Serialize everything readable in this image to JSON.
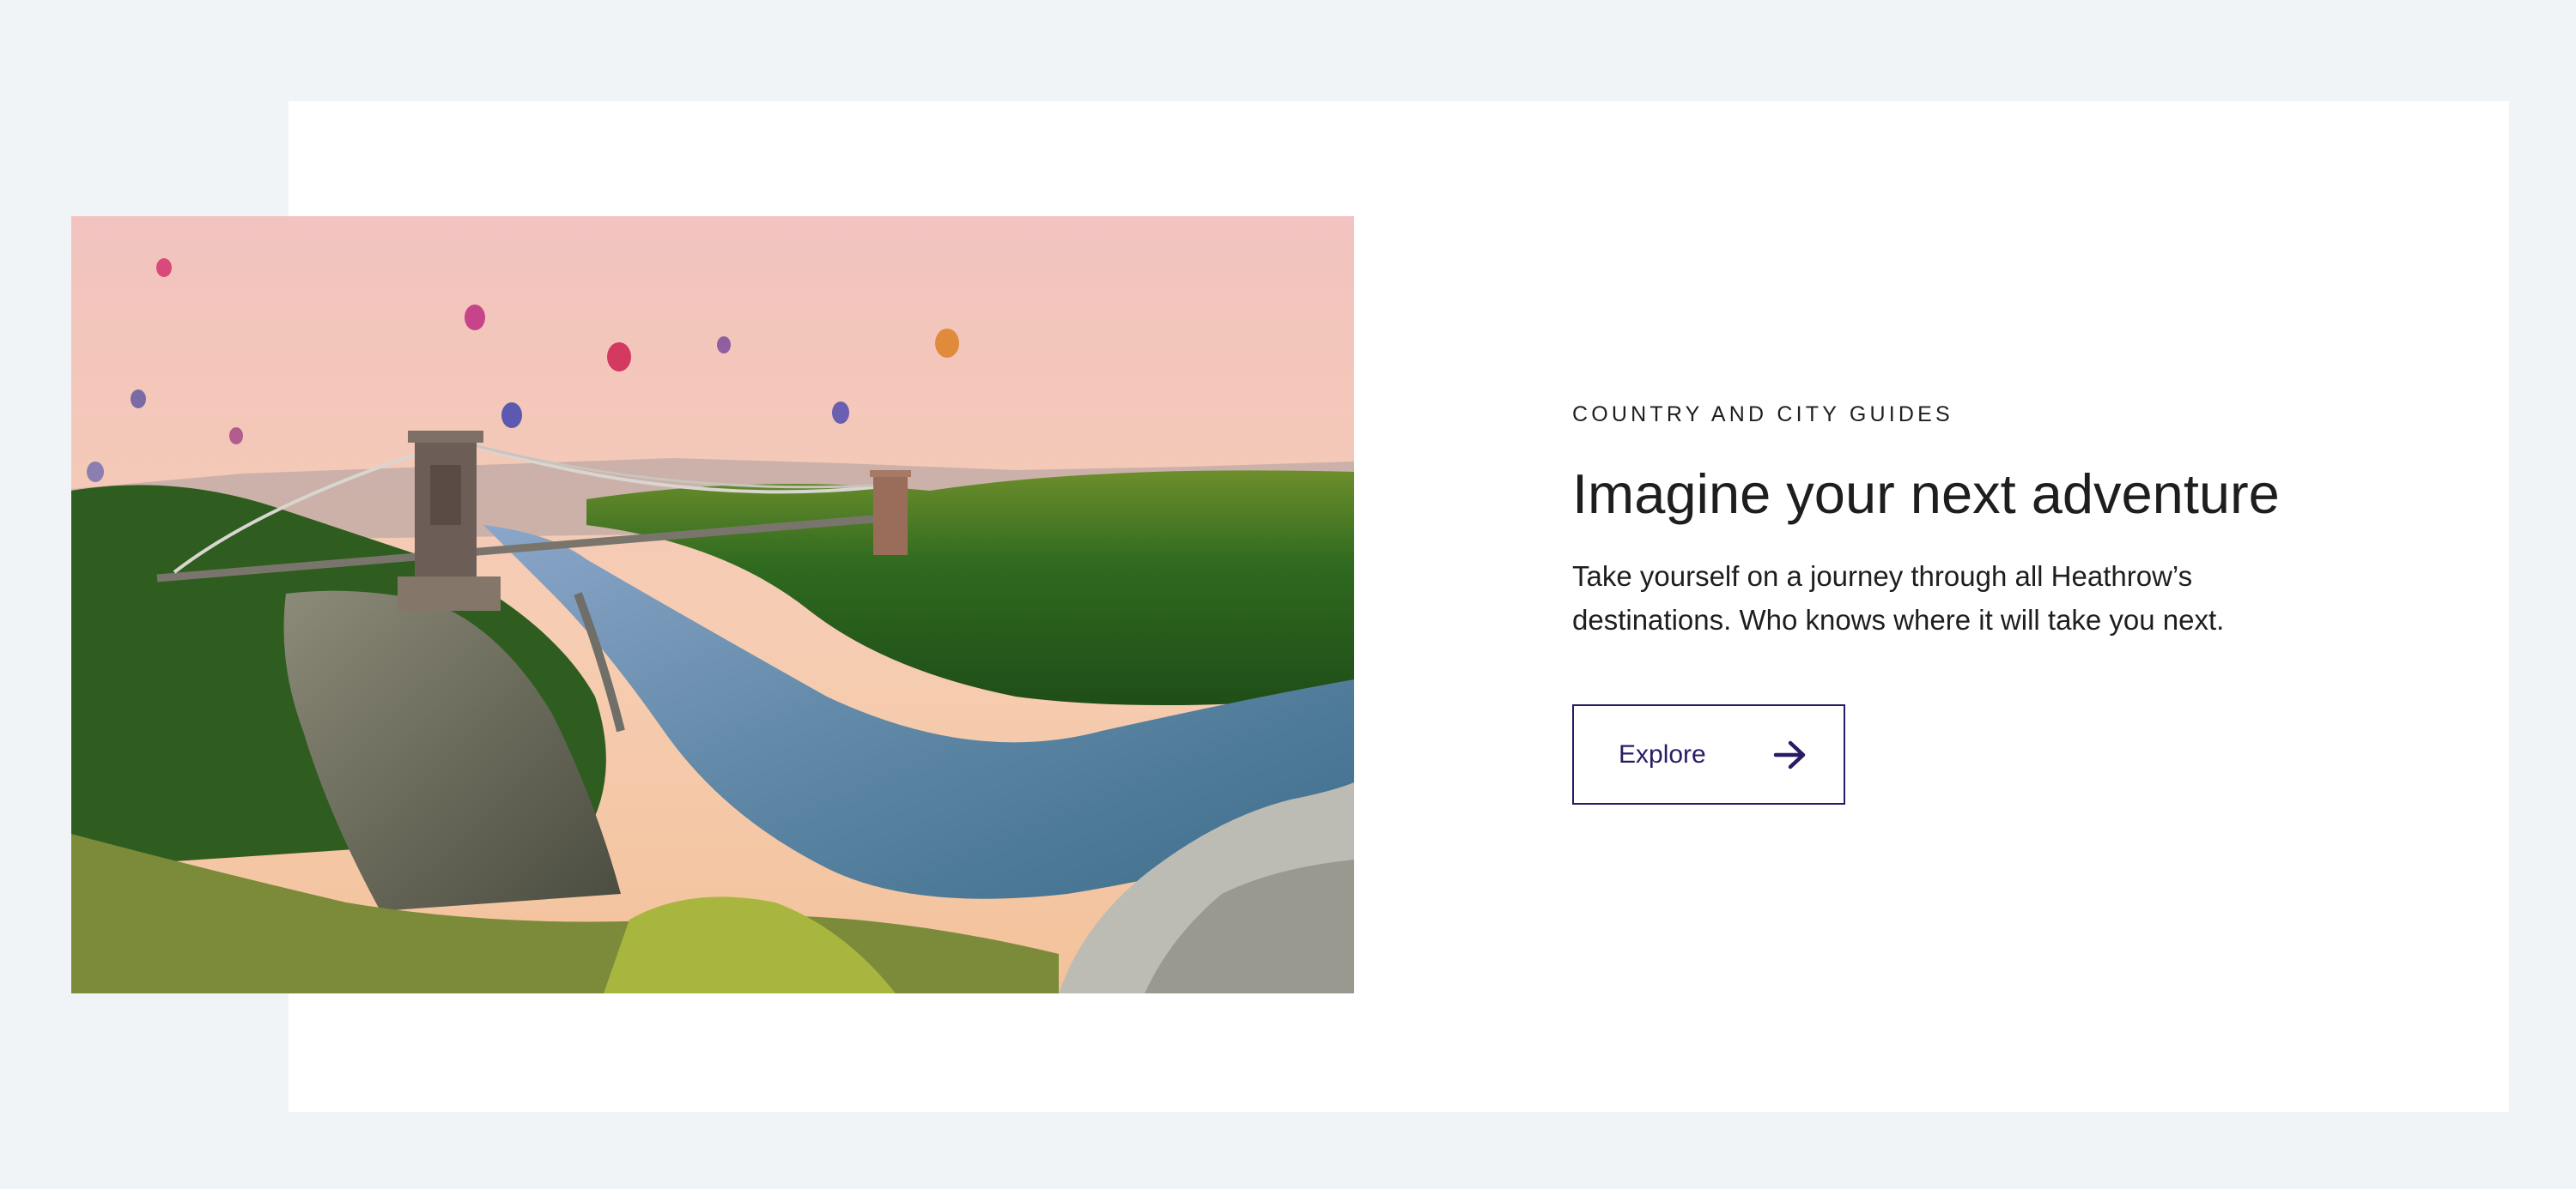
{
  "section": {
    "eyebrow": "COUNTRY AND CITY GUIDES",
    "headline": "Imagine your next adventure",
    "description": "Take yourself on a journey through all Heathrow’s destinations. Who knows where it will take you next.",
    "button_label": "Explore"
  },
  "image": {
    "subject": "suspension-bridge-gorge-balloons-photo"
  },
  "icons": {
    "button_icon": "arrow-right-icon"
  },
  "colors": {
    "page_background": "#f1f4f7",
    "card_background": "#ffffff",
    "text": "#1e1e1e",
    "accent": "#2b1b64"
  }
}
